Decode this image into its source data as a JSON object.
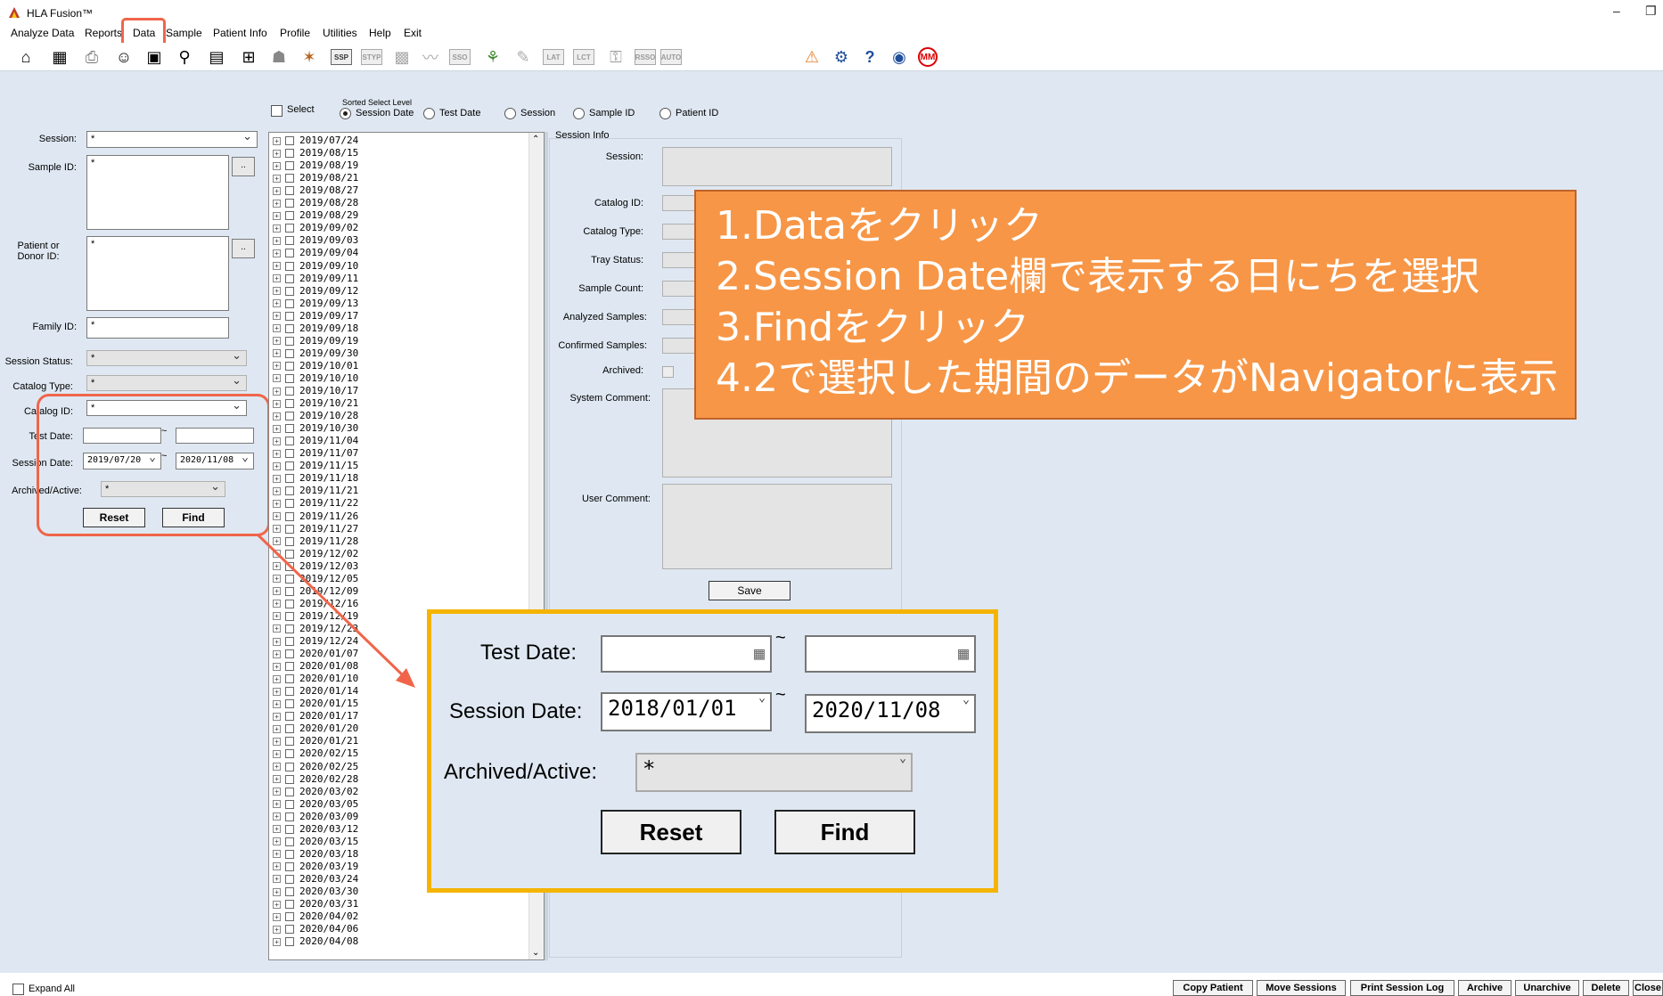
{
  "window": {
    "title": "HLA Fusion™"
  },
  "menu": [
    "Analyze Data",
    "Reports",
    "Data",
    "Sample",
    "Patient Info",
    "Profile",
    "Utilities",
    "Help",
    "Exit"
  ],
  "toolbar": {
    "boxed": [
      "SSP",
      "STYP",
      "SSO",
      "LAT",
      "LCT",
      "RSSO",
      "AUTO"
    ]
  },
  "select_bar": {
    "select_label": "Select",
    "sorted_label": "Sorted Select Level",
    "options": [
      "Session Date",
      "Test Date",
      "Session",
      "Sample ID",
      "Patient ID"
    ],
    "selected": "Session Date"
  },
  "filters": {
    "session_label": "Session:",
    "session_value": "*",
    "sample_id_label": "Sample ID:",
    "sample_id_value": "*",
    "patient_label": "Patient or Donor ID:",
    "patient_value": "*",
    "family_label": "Family ID:",
    "family_value": "*",
    "session_status_label": "Session Status:",
    "session_status_value": "*",
    "catalog_type_label": "Catalog Type:",
    "catalog_type_value": "*",
    "catalog_id_label": "Catalog ID:",
    "catalog_id_value": "*",
    "test_date_label": "Test Date:",
    "session_date_label": "Session Date:",
    "session_date_from": "2019/07/20",
    "session_date_to": "2020/11/08",
    "archived_label": "Archived/Active:",
    "archived_value": "*",
    "reset_label": "Reset",
    "find_label": "Find",
    "ellipsis": "..",
    "tilde": "~"
  },
  "tree_dates": [
    "2019/07/24",
    "2019/08/15",
    "2019/08/19",
    "2019/08/21",
    "2019/08/27",
    "2019/08/28",
    "2019/08/29",
    "2019/09/02",
    "2019/09/03",
    "2019/09/04",
    "2019/09/10",
    "2019/09/11",
    "2019/09/12",
    "2019/09/13",
    "2019/09/17",
    "2019/09/18",
    "2019/09/19",
    "2019/09/30",
    "2019/10/01",
    "2019/10/10",
    "2019/10/17",
    "2019/10/21",
    "2019/10/28",
    "2019/10/30",
    "2019/11/04",
    "2019/11/07",
    "2019/11/15",
    "2019/11/18",
    "2019/11/21",
    "2019/11/22",
    "2019/11/26",
    "2019/11/27",
    "2019/11/28",
    "2019/12/02",
    "2019/12/03",
    "2019/12/05",
    "2019/12/09",
    "2019/12/16",
    "2019/12/19",
    "2019/12/23",
    "2019/12/24",
    "2020/01/07",
    "2020/01/08",
    "2020/01/10",
    "2020/01/14",
    "2020/01/15",
    "2020/01/17",
    "2020/01/20",
    "2020/01/21",
    "2020/02/15",
    "2020/02/25",
    "2020/02/28",
    "2020/03/02",
    "2020/03/05",
    "2020/03/09",
    "2020/03/12",
    "2020/03/15",
    "2020/03/18",
    "2020/03/19",
    "2020/03/24",
    "2020/03/30",
    "2020/03/31",
    "2020/04/02",
    "2020/04/06",
    "2020/04/08"
  ],
  "session_info": {
    "title": "Session Info",
    "labels": [
      "Session:",
      "Catalog ID:",
      "Catalog Type:",
      "Tray Status:",
      "Sample Count:",
      "Analyzed Samples:",
      "Confirmed Samples:",
      "Archived:",
      "System Comment:",
      "User Comment:"
    ],
    "save_label": "Save"
  },
  "callout": [
    "1.Dataをクリック",
    "2.Session Date欄で表示する日にちを選択",
    "3.Findをクリック",
    "4.2で選択した期間のデータがNavigatorに表示"
  ],
  "zoom": {
    "test_date_label": "Test Date:",
    "session_date_label": "Session Date:",
    "session_from": "2018/01/01",
    "session_to": "2020/11/08",
    "archived_label": "Archived/Active:",
    "archived_value": "*",
    "reset_label": "Reset",
    "find_label": "Find",
    "tilde": "~"
  },
  "bottom": {
    "expand_all": "Expand All",
    "buttons": [
      "Copy Patient",
      "Move Sessions",
      "Print Session Log",
      "Archive",
      "Unarchive",
      "Delete",
      "Close"
    ]
  },
  "colors": {
    "highlight_red": "#f0654a",
    "callout_orange": "#f79646",
    "zoom_border": "#f4b400"
  }
}
